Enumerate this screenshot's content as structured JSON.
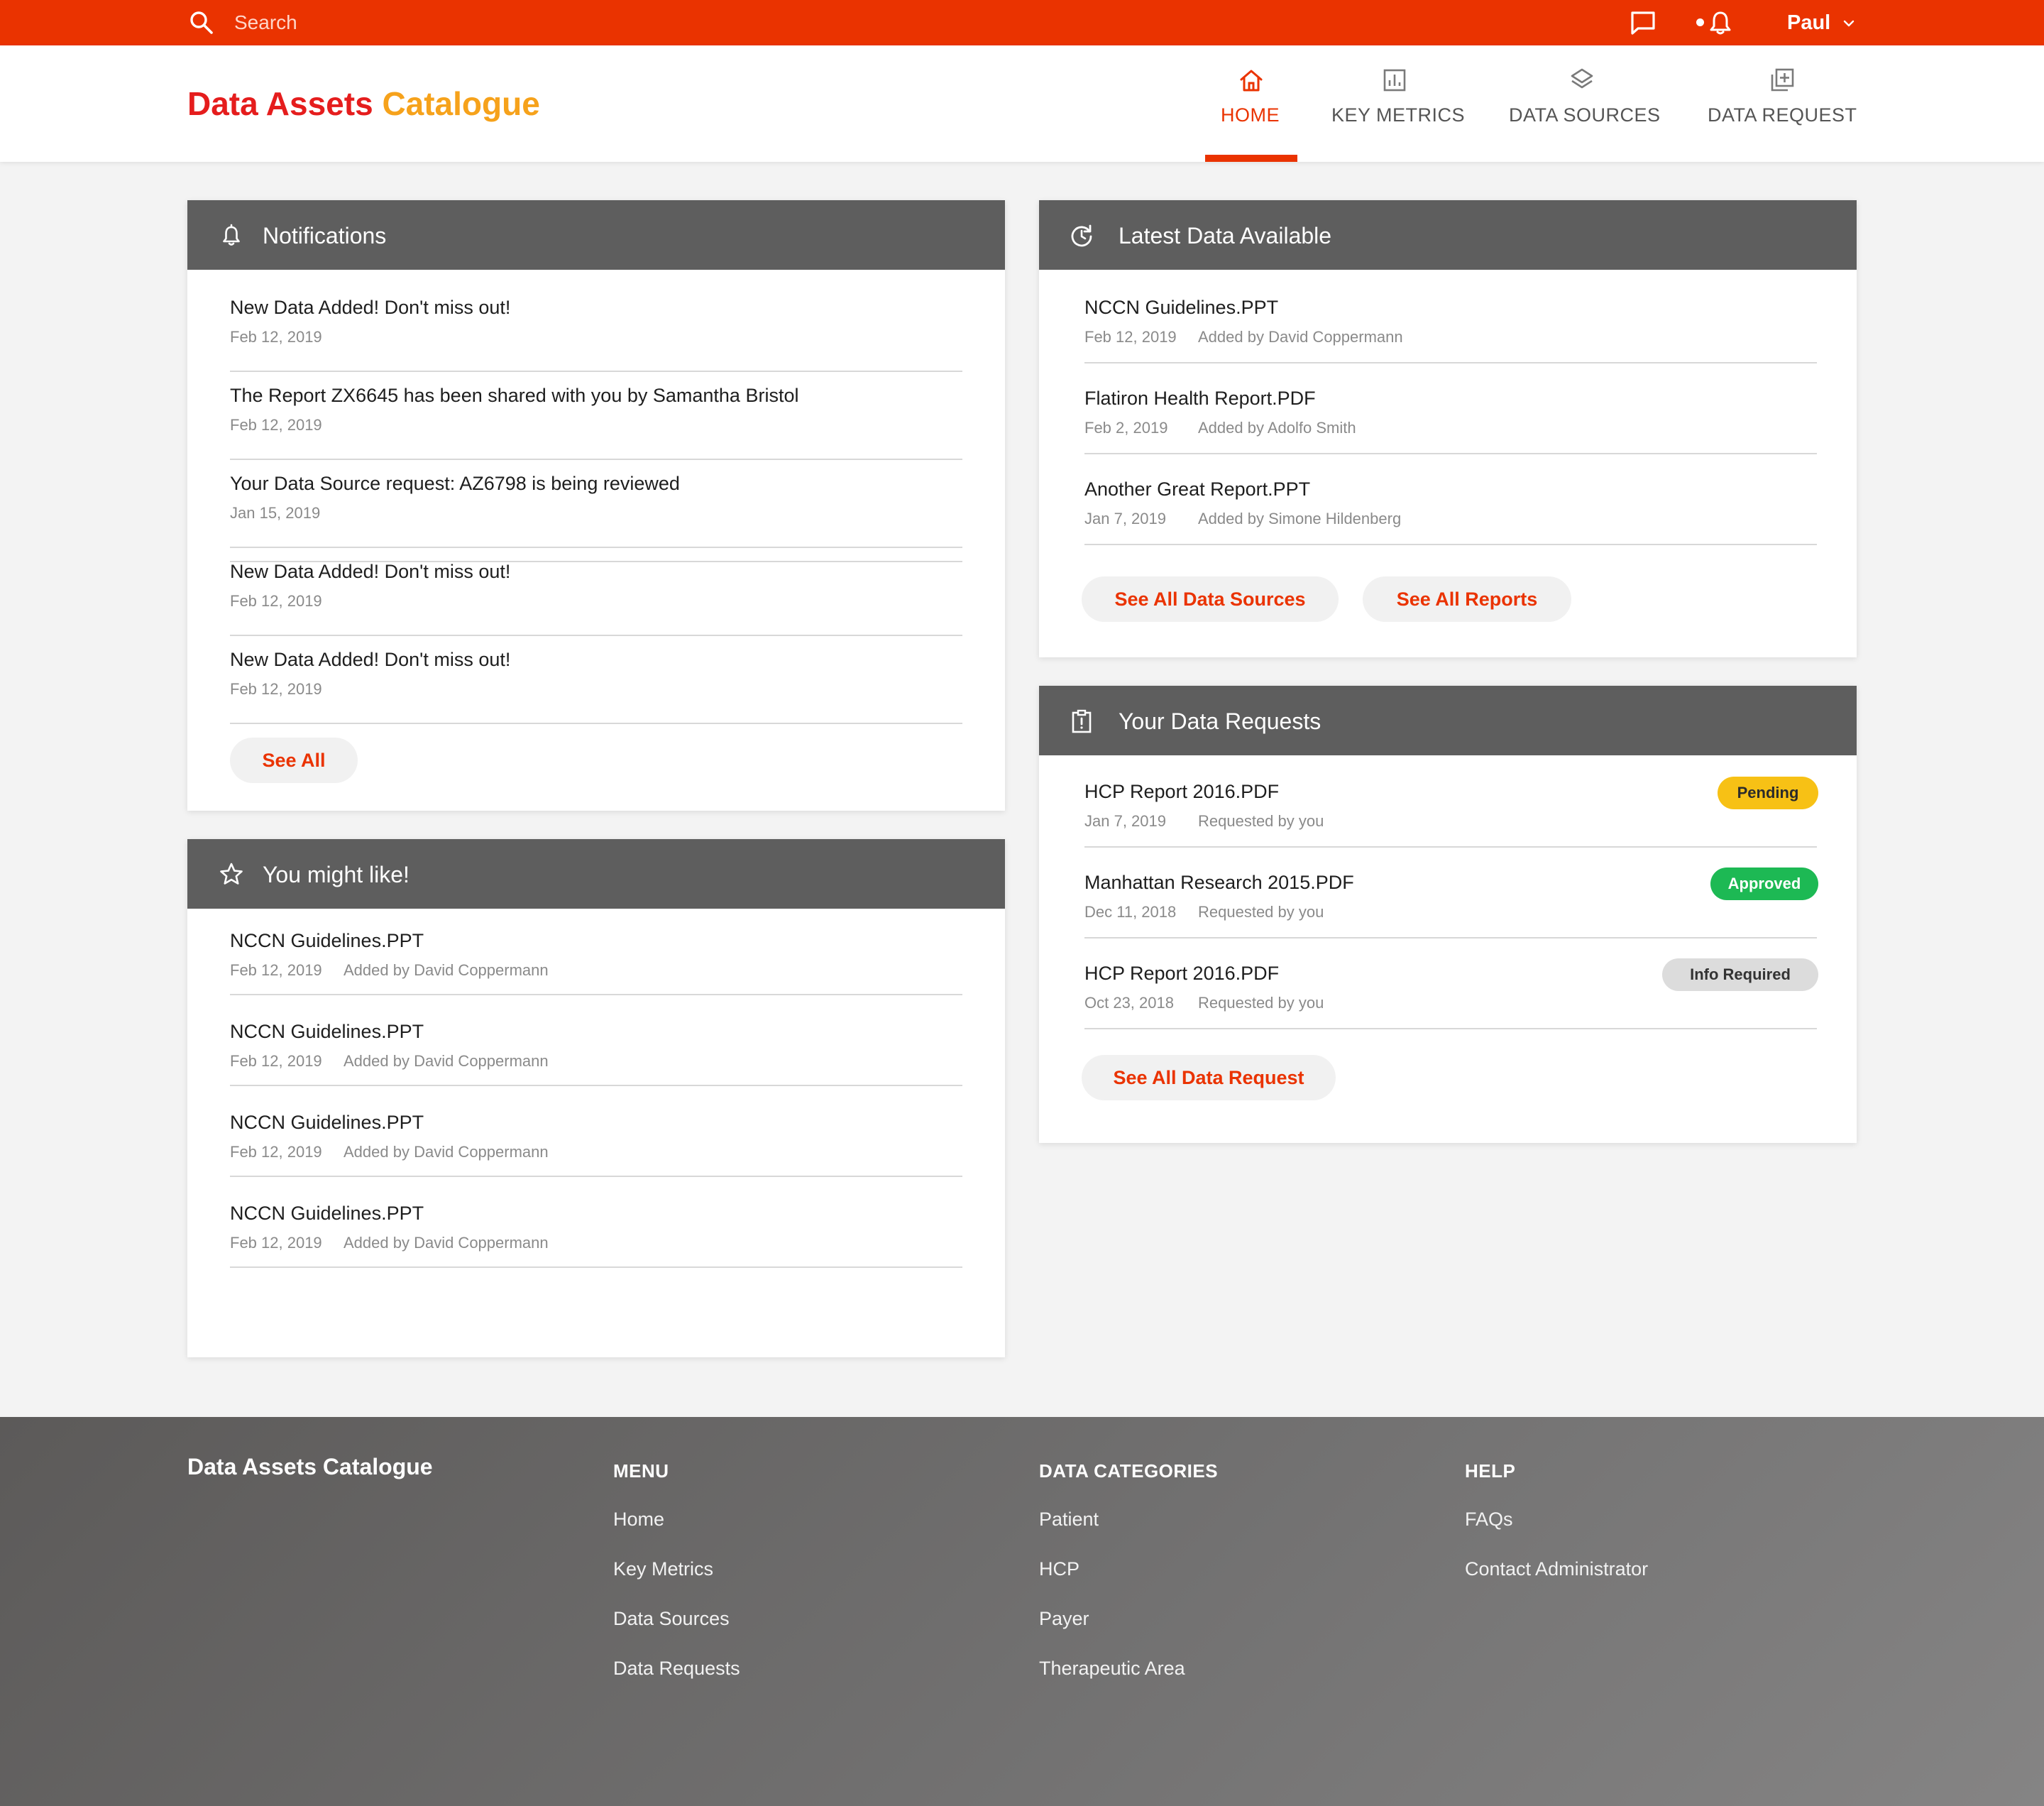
{
  "topbar": {
    "search_placeholder": "Search",
    "user_name": "Paul",
    "accent_color": "#ea3300",
    "icons": [
      "search-icon",
      "chat-icon",
      "bell-icon",
      "chevron-down-icon"
    ]
  },
  "header": {
    "brand_part1": "Data Assets",
    "brand_part2": "Catalogue",
    "brand_colors": [
      "#e51d1d",
      "#f6a21b"
    ],
    "nav": [
      {
        "label": "HOME",
        "icon": "home-icon",
        "active": true
      },
      {
        "label": "KEY METRICS",
        "icon": "bar-chart-icon",
        "active": false
      },
      {
        "label": "DATA SOURCES",
        "icon": "layers-icon",
        "active": false
      },
      {
        "label": "DATA REQUEST",
        "icon": "add-copy-icon",
        "active": false
      }
    ]
  },
  "notifications": {
    "title": "Notifications",
    "items": [
      {
        "text": "New Data Added! Don't miss out!",
        "date": "Feb 12, 2019"
      },
      {
        "text": "The Report ZX6645 has been shared with you by Samantha Bristol",
        "date": "Feb 12, 2019"
      },
      {
        "text": "Your Data Source request: AZ6798 is being reviewed",
        "date": "Jan 15, 2019"
      },
      {
        "text": "New Data Added! Don't miss out!",
        "date": "Feb 12, 2019"
      },
      {
        "text": "New Data Added! Don't miss out!",
        "date": "Feb 12, 2019"
      }
    ],
    "see_all": "See All"
  },
  "recommendations": {
    "title": "You might like!",
    "items": [
      {
        "name": "NCCN Guidelines.PPT",
        "date": "Feb 12, 2019",
        "by": "Added by David Coppermann"
      },
      {
        "name": "NCCN Guidelines.PPT",
        "date": "Feb 12, 2019",
        "by": "Added by David Coppermann"
      },
      {
        "name": "NCCN Guidelines.PPT",
        "date": "Feb 12, 2019",
        "by": "Added by David Coppermann"
      },
      {
        "name": "NCCN Guidelines.PPT",
        "date": "Feb 12, 2019",
        "by": "Added by David Coppermann"
      }
    ]
  },
  "latest": {
    "title": "Latest Data Available",
    "items": [
      {
        "name": "NCCN Guidelines.PPT",
        "date": "Feb 12, 2019",
        "by": "Added by David Coppermann"
      },
      {
        "name": "Flatiron Health Report.PDF",
        "date": "Feb 2, 2019",
        "by": "Added by Adolfo Smith"
      },
      {
        "name": "Another Great Report.PPT",
        "date": "Jan 7, 2019",
        "by": "Added by Simone Hildenberg"
      }
    ],
    "btn_sources": "See All Data Sources",
    "btn_reports": "See All Reports"
  },
  "requests": {
    "title": "Your Data Requests",
    "items": [
      {
        "name": "HCP Report 2016.PDF",
        "date": "Jan 7, 2019",
        "by": "Requested by you",
        "status": "Pending"
      },
      {
        "name": "Manhattan Research 2015.PDF",
        "date": "Dec 11, 2018",
        "by": "Requested by you",
        "status": "Approved"
      },
      {
        "name": "HCP Report 2016.PDF",
        "date": "Oct 23, 2018",
        "by": "Requested by you",
        "status": "Info Required"
      }
    ],
    "status_colors": {
      "Pending": "#f7c115",
      "Approved": "#1db954",
      "Info Required": "#dcdcdc"
    },
    "see_all": "See All Data Request"
  },
  "footer": {
    "brand": "Data Assets Catalogue",
    "columns": [
      {
        "heading": "MENU",
        "links": [
          "Home",
          "Key Metrics",
          "Data Sources",
          "Data Requests"
        ]
      },
      {
        "heading": "DATA CATEGORIES",
        "links": [
          "Patient",
          "HCP",
          "Payer",
          "Therapeutic Area"
        ]
      },
      {
        "heading": "HELP",
        "links": [
          "FAQs",
          "Contact Administrator"
        ]
      }
    ]
  }
}
